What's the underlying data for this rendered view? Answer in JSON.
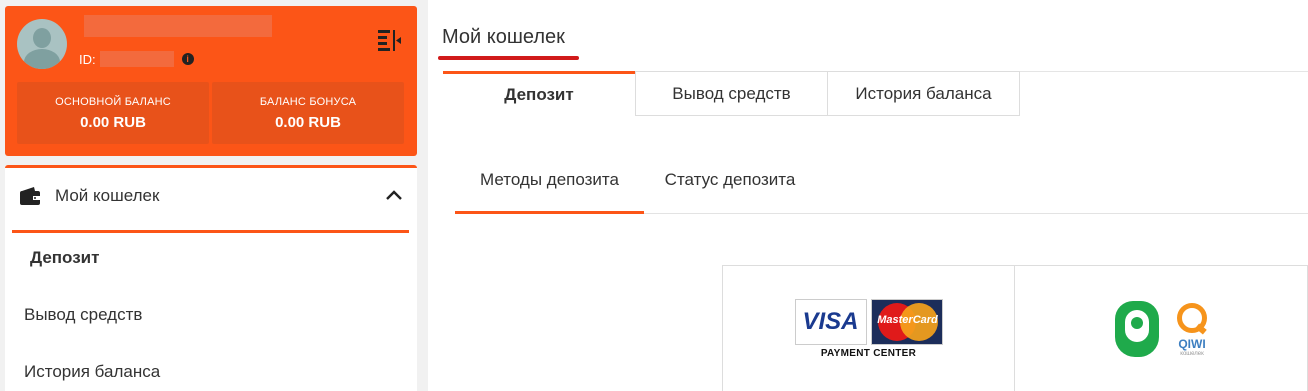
{
  "profile": {
    "id_label": "ID:",
    "info_icon": "info-icon",
    "collapse_icon": "collapse-sidebar-icon"
  },
  "balances": [
    {
      "label": "ОСНОВНОЙ БАЛАНС",
      "value": "0.00 RUB"
    },
    {
      "label": "БАЛАНС БОНУСА",
      "value": "0.00 RUB"
    }
  ],
  "menu": {
    "title": "Мой кошелек",
    "items": [
      {
        "label": "Депозит",
        "active": true
      },
      {
        "label": "Вывод средств",
        "active": false
      },
      {
        "label": "История баланса",
        "active": false
      }
    ]
  },
  "main": {
    "title": "Мой кошелек",
    "tabs": [
      {
        "label": "Депозит",
        "active": true
      },
      {
        "label": "Вывод средств",
        "active": false
      },
      {
        "label": "История баланса",
        "active": false
      }
    ],
    "subtabs": [
      {
        "label": "Методы депозита",
        "active": true
      },
      {
        "label": "Статус депозита",
        "active": false
      }
    ],
    "methods": {
      "card": {
        "visa": "VISA",
        "mastercard": "MasterCard",
        "caption": "PAYMENT CENTER"
      },
      "qiwi": {
        "label": "QIWI",
        "sub": "кошелек"
      }
    }
  },
  "colors": {
    "accent": "#fc5517",
    "title_underline": "#d11a1a"
  }
}
